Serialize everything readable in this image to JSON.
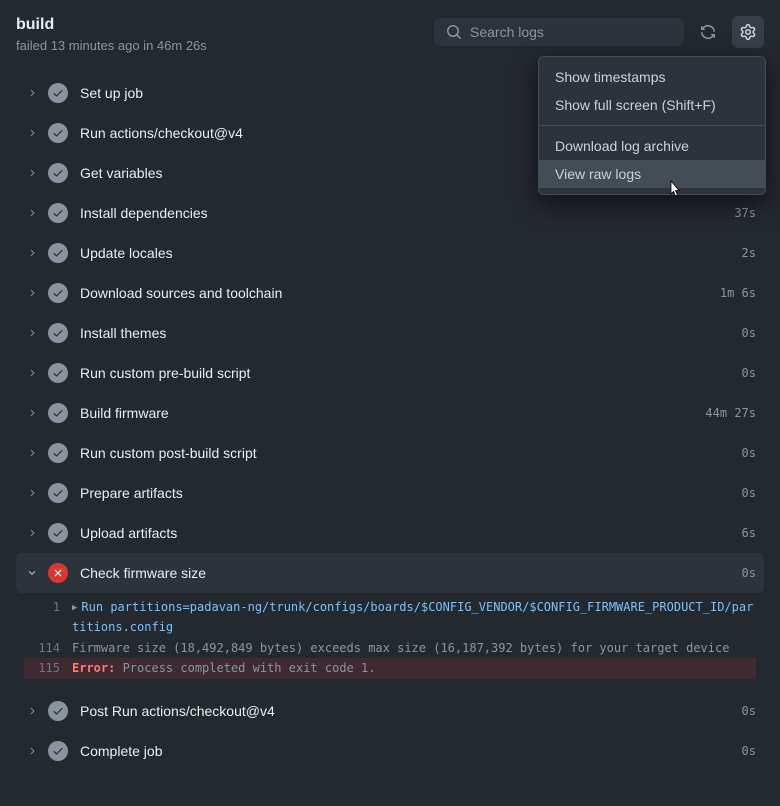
{
  "header": {
    "title": "build",
    "subtitle": "failed 13 minutes ago in 46m 26s",
    "search_placeholder": "Search logs"
  },
  "dropdown": {
    "show_timestamps": "Show timestamps",
    "show_full_screen": "Show full screen (Shift+F)",
    "download_log": "Download log archive",
    "view_raw": "View raw logs"
  },
  "steps": [
    {
      "name": "Set up job",
      "status": "success",
      "duration": "",
      "expanded": false
    },
    {
      "name": "Run actions/checkout@v4",
      "status": "success",
      "duration": "",
      "expanded": false
    },
    {
      "name": "Get variables",
      "status": "success",
      "duration": "",
      "expanded": false
    },
    {
      "name": "Install dependencies",
      "status": "success",
      "duration": "37s",
      "expanded": false
    },
    {
      "name": "Update locales",
      "status": "success",
      "duration": "2s",
      "expanded": false
    },
    {
      "name": "Download sources and toolchain",
      "status": "success",
      "duration": "1m 6s",
      "expanded": false
    },
    {
      "name": "Install themes",
      "status": "success",
      "duration": "0s",
      "expanded": false
    },
    {
      "name": "Run custom pre-build script",
      "status": "success",
      "duration": "0s",
      "expanded": false
    },
    {
      "name": "Build firmware",
      "status": "success",
      "duration": "44m 27s",
      "expanded": false
    },
    {
      "name": "Run custom post-build script",
      "status": "success",
      "duration": "0s",
      "expanded": false
    },
    {
      "name": "Prepare artifacts",
      "status": "success",
      "duration": "0s",
      "expanded": false
    },
    {
      "name": "Upload artifacts",
      "status": "success",
      "duration": "6s",
      "expanded": false
    },
    {
      "name": "Check firmware size",
      "status": "failure",
      "duration": "0s",
      "expanded": true
    },
    {
      "name": "Post Run actions/checkout@v4",
      "status": "success",
      "duration": "0s",
      "expanded": false
    },
    {
      "name": "Complete job",
      "status": "success",
      "duration": "0s",
      "expanded": false
    }
  ],
  "log": {
    "lines": [
      {
        "no": "1",
        "type": "cmd",
        "text": "Run partitions=padavan-ng/trunk/configs/boards/$CONFIG_VENDOR/$CONFIG_FIRMWARE_PRODUCT_ID/partitions.config"
      },
      {
        "no": "114",
        "type": "plain",
        "text": "Firmware size (18,492,849 bytes) exceeds max size (16,187,392 bytes) for your target device"
      },
      {
        "no": "115",
        "type": "error",
        "prefix": "Error:",
        "text": " Process completed with exit code 1."
      }
    ]
  }
}
